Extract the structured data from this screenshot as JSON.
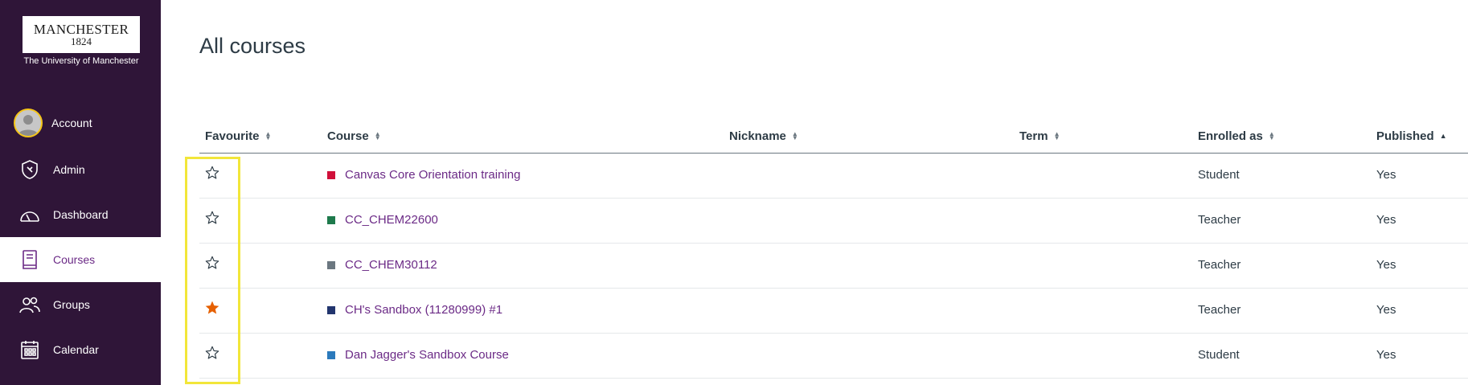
{
  "logo": {
    "name": "MANCHESTER",
    "year": "1824",
    "subtitle": "The University of Manchester"
  },
  "sidebar": {
    "items": [
      {
        "label": "Account",
        "icon": "avatar-icon"
      },
      {
        "label": "Admin",
        "icon": "shield-icon"
      },
      {
        "label": "Dashboard",
        "icon": "dashboard-gauge-icon"
      },
      {
        "label": "Courses",
        "icon": "book-icon",
        "active": true
      },
      {
        "label": "Groups",
        "icon": "groups-icon"
      },
      {
        "label": "Calendar",
        "icon": "calendar-icon"
      }
    ]
  },
  "page": {
    "title": "All courses"
  },
  "table": {
    "headers": {
      "favourite": "Favourite",
      "course": "Course",
      "nickname": "Nickname",
      "term": "Term",
      "enrolled_as": "Enrolled as",
      "published": "Published"
    },
    "rows": [
      {
        "favourite": false,
        "course": "Canvas Core Orientation training",
        "color": "#d0103a",
        "nickname": "",
        "term": "",
        "enrolled_as": "Student",
        "published": "Yes"
      },
      {
        "favourite": false,
        "course": "CC_CHEM22600",
        "color": "#1e7a4c",
        "nickname": "",
        "term": "",
        "enrolled_as": "Teacher",
        "published": "Yes"
      },
      {
        "favourite": false,
        "course": "CC_CHEM30112",
        "color": "#6b7780",
        "nickname": "",
        "term": "",
        "enrolled_as": "Teacher",
        "published": "Yes"
      },
      {
        "favourite": true,
        "course": "CH's Sandbox (11280999) #1",
        "color": "#22356e",
        "nickname": "",
        "term": "",
        "enrolled_as": "Teacher",
        "published": "Yes"
      },
      {
        "favourite": false,
        "course": "Dan Jagger's Sandbox Course",
        "color": "#2b7abc",
        "nickname": "",
        "term": "",
        "enrolled_as": "Student",
        "published": "Yes"
      }
    ]
  },
  "colors": {
    "sidebar_bg": "#2f1538",
    "accent": "#6b2a86",
    "star_filled": "#e66000",
    "highlight": "#f2e63a"
  }
}
